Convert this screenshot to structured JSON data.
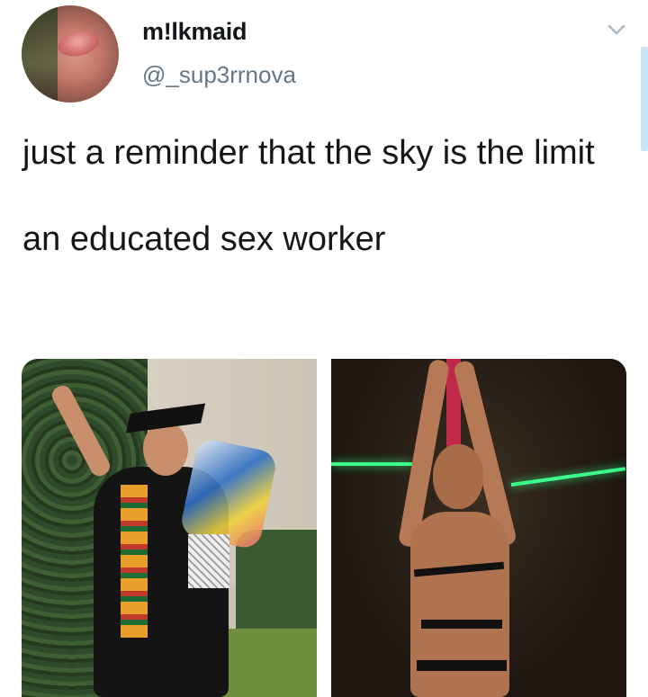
{
  "tweet": {
    "author": {
      "display_name": "m!lkmaid",
      "handle": "@_sup3rrnova",
      "avatar_icon": "profile-photo"
    },
    "menu_icon": "chevron-down-icon",
    "text": "just a reminder that the sky is the limit\n\nan educated sex worker",
    "media": [
      {
        "icon": "photo-graduation"
      },
      {
        "icon": "photo-pole-dancer"
      }
    ]
  },
  "colors": {
    "text": "#14171a",
    "secondary_text": "#657786",
    "scrollbar": "#c7e3f4"
  }
}
